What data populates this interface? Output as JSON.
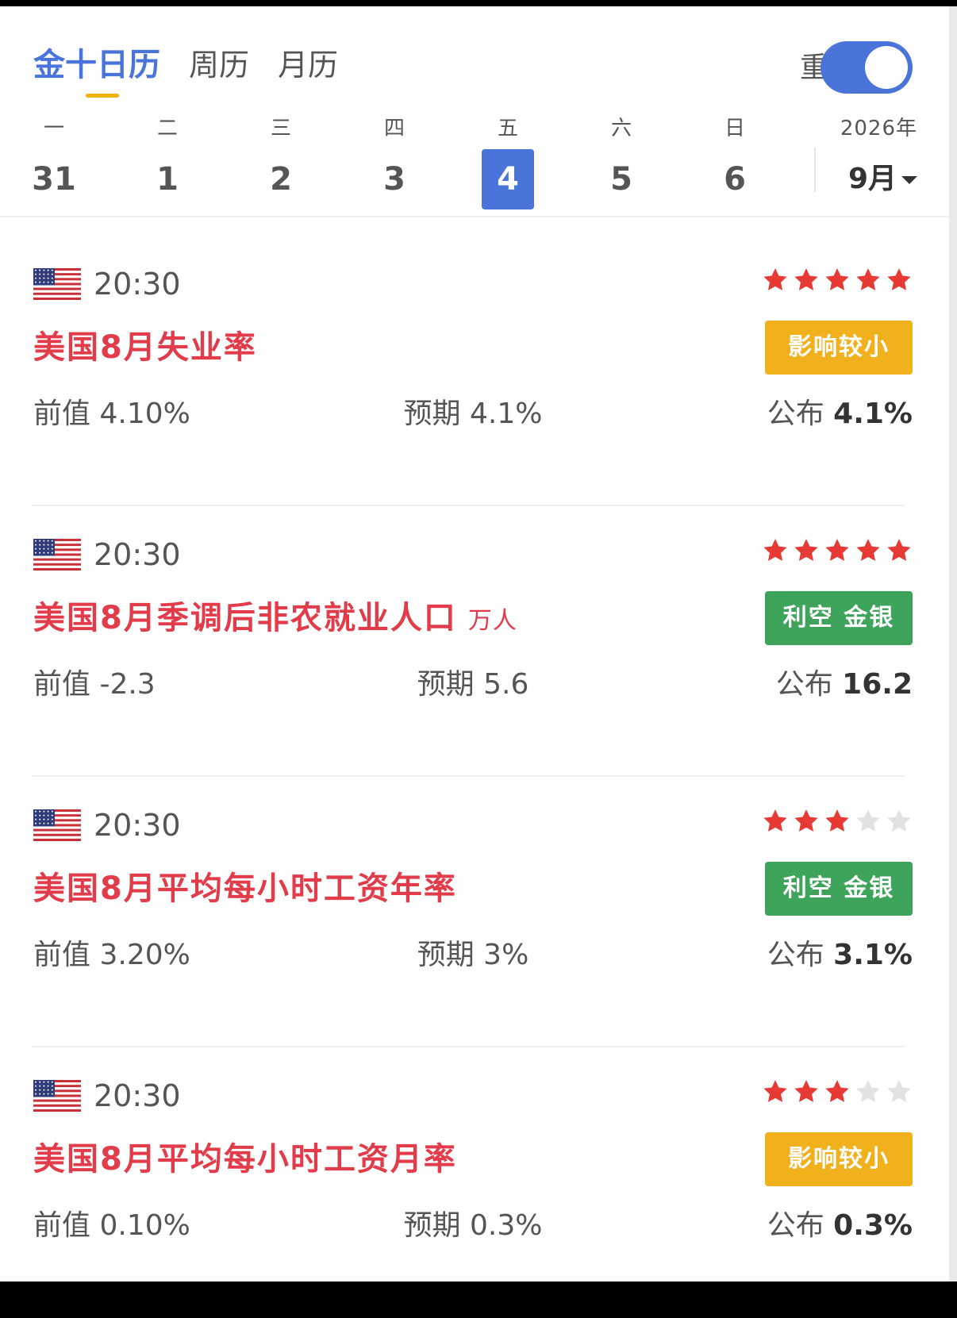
{
  "header": {
    "tabs": [
      {
        "label": "金十日历",
        "active": true
      },
      {
        "label": "周历",
        "active": false
      },
      {
        "label": "月历",
        "active": false
      }
    ],
    "important_label": "重要",
    "important_on": true,
    "accent_color": "#4a74d9"
  },
  "week": {
    "days": [
      {
        "weekday": "一",
        "date": "31"
      },
      {
        "weekday": "二",
        "date": "1"
      },
      {
        "weekday": "三",
        "date": "2"
      },
      {
        "weekday": "四",
        "date": "3"
      },
      {
        "weekday": "五",
        "date": "4",
        "selected": true
      },
      {
        "weekday": "六",
        "date": "5"
      },
      {
        "weekday": "日",
        "date": "6"
      }
    ],
    "year": "2026年",
    "month": "9月"
  },
  "events": [
    {
      "flag": "us-flag-icon",
      "time": "20:30",
      "stars": 5,
      "title": "美国8月失业率",
      "unit": "",
      "badge": "影响较小",
      "badge_color": "#f1b11d",
      "prev_label": "前值",
      "prev_value": "4.10%",
      "expected_label": "预期",
      "expected_value": "4.1%",
      "published_label": "公布",
      "published_value": "4.1%"
    },
    {
      "flag": "us-flag-icon",
      "time": "20:30",
      "stars": 5,
      "title": "美国8月季调后非农就业人口",
      "unit": "万人",
      "badge": "利空 金银",
      "badge_color": "#3ea35b",
      "prev_label": "前值",
      "prev_value": "-2.3",
      "expected_label": "预期",
      "expected_value": "5.6",
      "published_label": "公布",
      "published_value": "16.2"
    },
    {
      "flag": "us-flag-icon",
      "time": "20:30",
      "stars": 3,
      "title": "美国8月平均每小时工资年率",
      "unit": "",
      "badge": "利空 金银",
      "badge_color": "#3ea35b",
      "prev_label": "前值",
      "prev_value": "3.20%",
      "expected_label": "预期",
      "expected_value": "3%",
      "published_label": "公布",
      "published_value": "3.1%"
    },
    {
      "flag": "us-flag-icon",
      "time": "20:30",
      "stars": 3,
      "title": "美国8月平均每小时工资月率",
      "unit": "",
      "badge": "影响较小",
      "badge_color": "#f1b11d",
      "prev_label": "前值",
      "prev_value": "0.10%",
      "expected_label": "预期",
      "expected_value": "0.3%",
      "published_label": "公布",
      "published_value": "0.3%"
    }
  ],
  "colors": {
    "star_on": "#e83a34",
    "star_off": "#e2e2e2",
    "title": "#e23b4a"
  }
}
